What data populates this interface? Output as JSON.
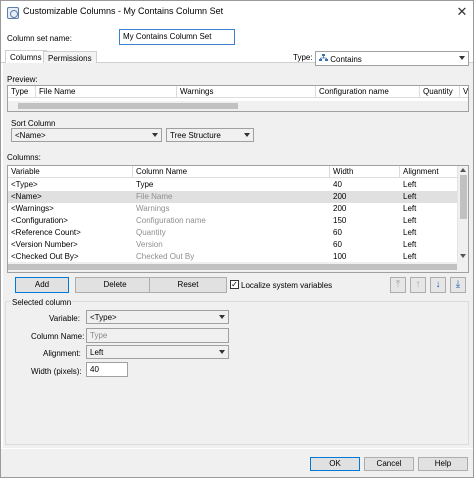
{
  "window": {
    "title": "Customizable Columns - My Contains Column Set",
    "close_glyph": "✕"
  },
  "column_set": {
    "label": "Column set name:",
    "value": "My Contains Column Set"
  },
  "tabs": [
    {
      "label": "Columns"
    },
    {
      "label": "Permissions"
    }
  ],
  "type": {
    "label": "Type:",
    "value": "Contains",
    "icon": "network-icon"
  },
  "preview": {
    "label": "Preview:",
    "columns": [
      "Type",
      "File Name",
      "Warnings",
      "Configuration name",
      "Quantity",
      "Ve"
    ]
  },
  "sort": {
    "label": "Sort Column",
    "column_value": "<Name>",
    "mode_value": "Tree Structure"
  },
  "columns_grid": {
    "label": "Columns:",
    "headers": [
      "Variable",
      "Column Name",
      "Width",
      "Alignment"
    ],
    "rows": [
      {
        "variable": "<Type>",
        "column": "Type",
        "width": "40",
        "align": "Left",
        "selected": false,
        "grey": false
      },
      {
        "variable": "<Name>",
        "column": "File Name",
        "width": "200",
        "align": "Left",
        "selected": true,
        "grey": true
      },
      {
        "variable": "<Warnings>",
        "column": "Warnings",
        "width": "200",
        "align": "Left",
        "selected": false,
        "grey": true
      },
      {
        "variable": "<Configuration>",
        "column": "Configuration name",
        "width": "150",
        "align": "Left",
        "selected": false,
        "grey": true
      },
      {
        "variable": "<Reference Count>",
        "column": "Quantity",
        "width": "60",
        "align": "Left",
        "selected": false,
        "grey": true
      },
      {
        "variable": "<Version Number>",
        "column": "Version",
        "width": "60",
        "align": "Left",
        "selected": false,
        "grey": true
      },
      {
        "variable": "<Checked Out By>",
        "column": "Checked Out By",
        "width": "100",
        "align": "Left",
        "selected": false,
        "grey": true
      }
    ]
  },
  "actions": {
    "add": "Add",
    "delete": "Delete",
    "reset": "Reset",
    "localize": "Localize system variables",
    "localize_checked": "✓"
  },
  "move_icons": {
    "top": "⤒",
    "up": "↑",
    "down": "↓",
    "bottom": "⤓"
  },
  "selected_column": {
    "title": "Selected column",
    "variable_label": "Variable:",
    "variable_value": "<Type>",
    "name_label": "Column Name:",
    "name_value": "Type",
    "alignment_label": "Alignment:",
    "alignment_value": "Left",
    "width_label": "Width (pixels):",
    "width_value": "40"
  },
  "footer": {
    "ok": "OK",
    "cancel": "Cancel",
    "help": "Help"
  },
  "colors": {
    "focus_border": "#3c7fd1",
    "default_button_border": "#0078d7",
    "selected_row": "#e0e0e0"
  }
}
